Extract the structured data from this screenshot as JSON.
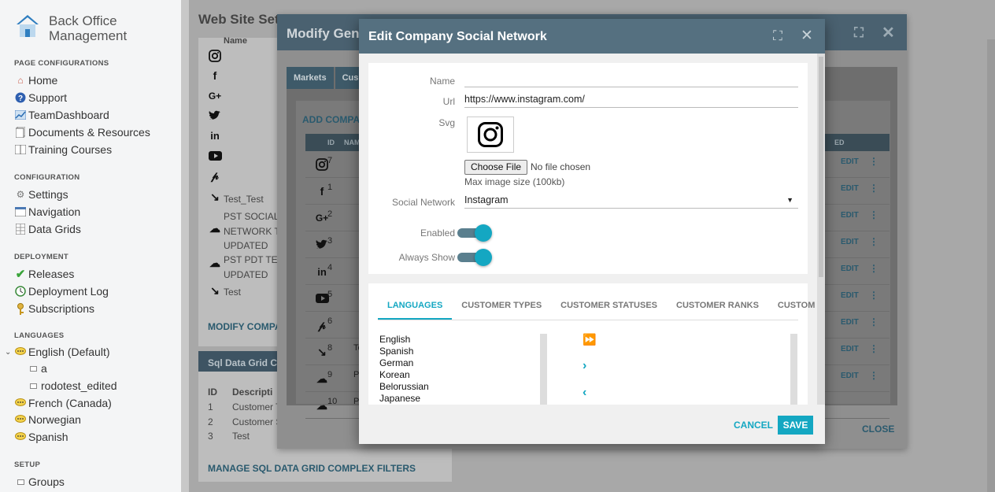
{
  "brand": {
    "line1": "Back Office",
    "line2": "Management"
  },
  "sidebar": {
    "sections": {
      "page_config": "PAGE CONFIGURATIONS",
      "configuration": "CONFIGURATION",
      "deployment": "DEPLOYMENT",
      "languages": "LANGUAGES",
      "setup": "SETUP"
    },
    "page_config_items": [
      "Home",
      "Support",
      "TeamDashboard",
      "Documents & Resources",
      "Training Courses"
    ],
    "configuration_items": [
      "Settings",
      "Navigation",
      "Data Grids"
    ],
    "deployment_items": [
      "Releases",
      "Deployment Log",
      "Subscriptions"
    ],
    "language_items": [
      "English (Default)",
      "a",
      "rodotest_edited",
      "French (Canada)",
      "Norwegian",
      "Spanish"
    ],
    "setup_items": [
      "Groups"
    ]
  },
  "background": {
    "page_title": "Web Site Sett",
    "name_header": "Name",
    "names": [
      "Test_Test",
      "PST SOCIAL",
      "NETWORK T",
      "UPDATED",
      "PST PDT TE",
      "UPDATED",
      "Test"
    ],
    "modify_link": "MODIFY COMPA",
    "sql_header": "Sql Data Grid C",
    "sql_cols": [
      "ID",
      "Descripti"
    ],
    "sql_rows": [
      [
        "1",
        "Customer T"
      ],
      [
        "2",
        "Customer S"
      ],
      [
        "3",
        "Test"
      ]
    ],
    "manage_link": "MANAGE SQL DATA GRID COMPLEX FILTERS"
  },
  "dialog1": {
    "title": "Modify Gene",
    "tabs": [
      "Markets",
      "Cus"
    ],
    "add_button": "ADD COMPAN",
    "grid_cols": [
      "ID",
      "NAM",
      "ED"
    ],
    "rows": [
      {
        "id": "7",
        "name": ""
      },
      {
        "id": "1",
        "name": ""
      },
      {
        "id": "2",
        "name": ""
      },
      {
        "id": "3",
        "name": ""
      },
      {
        "id": "4",
        "name": ""
      },
      {
        "id": "5",
        "name": ""
      },
      {
        "id": "6",
        "name": ""
      },
      {
        "id": "8",
        "name": "Tes"
      },
      {
        "id": "9",
        "name": "PST"
      },
      {
        "id": "10",
        "name": "PST"
      }
    ],
    "edit_label": "EDIT",
    "close_label": "CLOSE"
  },
  "dialog": {
    "title": "Edit Company Social Network",
    "labels": {
      "name": "Name",
      "url": "Url",
      "svg": "Svg",
      "social_network": "Social Network",
      "enabled": "Enabled",
      "always_show": "Always Show"
    },
    "values": {
      "name": "",
      "url": "https://www.instagram.com/",
      "social_network": "Instagram",
      "enabled": true,
      "always_show": true
    },
    "file_button": "Choose File",
    "file_status": "No file chosen",
    "max_size_hint": "Max image size (100kb)",
    "tabs": [
      "LANGUAGES",
      "CUSTOMER TYPES",
      "CUSTOMER STATUSES",
      "CUSTOMER RANKS",
      "CUSTOM"
    ],
    "languages": [
      "English",
      "Spanish",
      "German",
      "Korean",
      "Belorussian",
      "Japanese"
    ],
    "cancel": "CANCEL",
    "save": "SAVE"
  },
  "colors": {
    "accent": "#14a7c2",
    "header": "#557080"
  }
}
